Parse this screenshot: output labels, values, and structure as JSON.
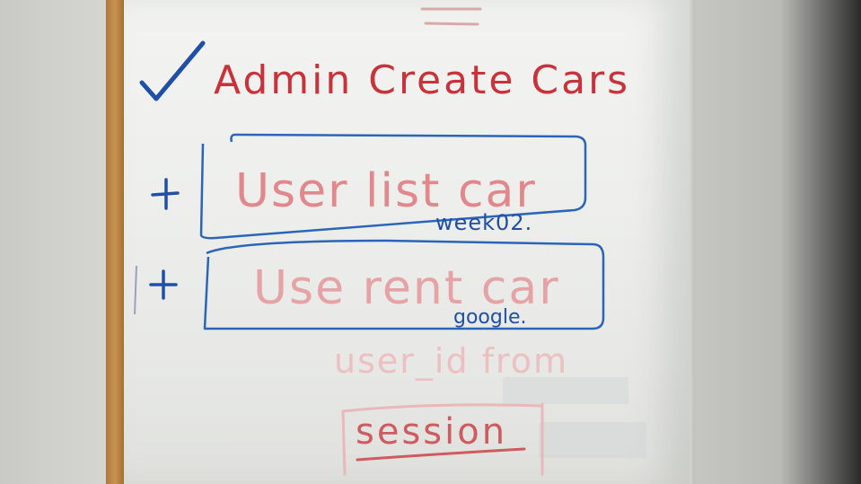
{
  "whiteboard": {
    "line1": "Admin Create Cars",
    "line2": "User list car",
    "note2": "week02.",
    "line3": "Use rent car",
    "note3": "google.",
    "line4": "user_id from",
    "line5": "session"
  },
  "colors": {
    "red_marker": "#c8323a",
    "faded_red": "#e6a3a6",
    "blue_marker": "#1f4fa6",
    "board": "#eeefec",
    "frame": "#c89250"
  },
  "icons": {
    "check": "checkmark-icon",
    "plus": "plus-icon"
  }
}
